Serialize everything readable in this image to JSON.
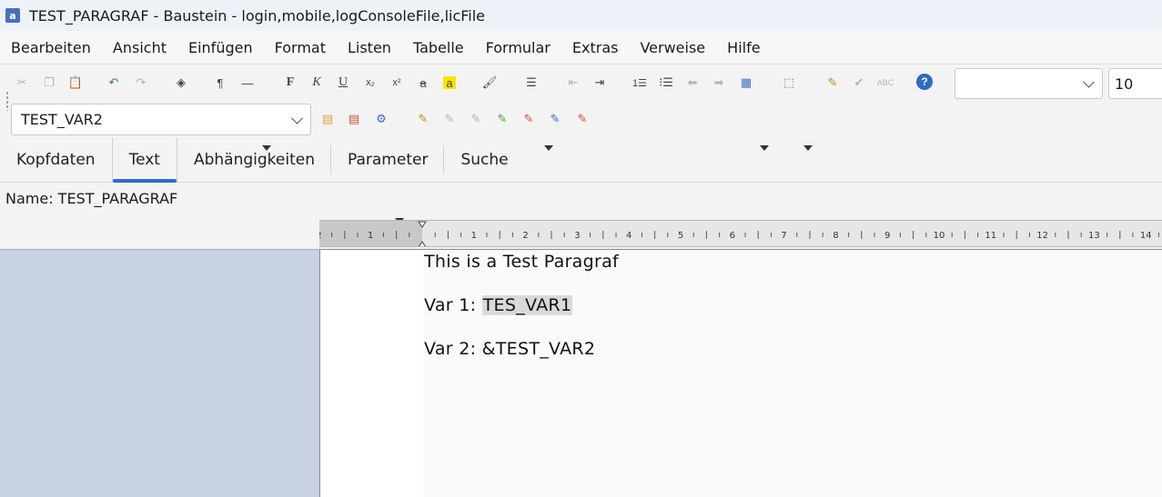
{
  "window": {
    "title": "TEST_PARAGRAF - Baustein - login,mobile,logConsoleFile,licFile"
  },
  "menu": [
    "Bearbeiten",
    "Ansicht",
    "Einfügen",
    "Format",
    "Listen",
    "Tabelle",
    "Formular",
    "Extras",
    "Verweise",
    "Hilfe"
  ],
  "toolbar": {
    "font_name_value": "",
    "font_size_value": "10",
    "variable_select_value": "TEST_VAR2"
  },
  "tabs": [
    "Kopfdaten",
    "Text",
    "Abhängigkeiten",
    "Parameter",
    "Suche"
  ],
  "active_tab": "Text",
  "name_line": "Name: TEST_PARAGRAF",
  "ruler": {
    "labels": [
      "2",
      "1",
      "",
      "1",
      "2",
      "3",
      "4",
      "5",
      "6",
      "7",
      "8",
      "9",
      "10",
      "11",
      "12",
      "13",
      "14"
    ]
  },
  "document": {
    "line1": "This is a Test Paragraf",
    "line2_prefix": "Var 1: ",
    "line2_field": "TES_VAR1",
    "line3": "Var 2: &TEST_VAR2"
  }
}
